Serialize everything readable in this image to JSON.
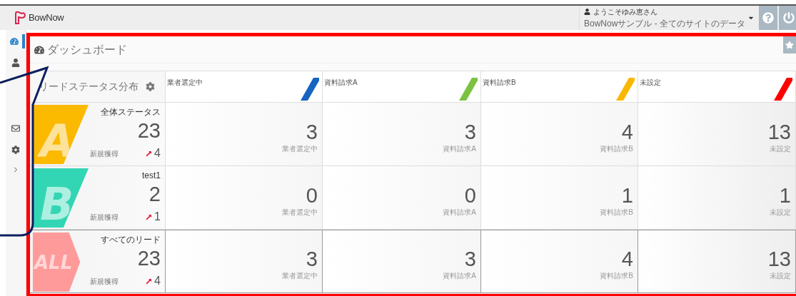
{
  "app": {
    "logo": "BowNow"
  },
  "user": {
    "greeting": "ようこそゆみ恵さん",
    "site": "BowNowサンプル - 全てのサイトのデータ"
  },
  "sidebar": [
    {
      "kind": "dashboard",
      "selected": true
    },
    {
      "kind": "person",
      "selected": false
    },
    {
      "kind": "mail",
      "selected": false
    },
    {
      "kind": "gear",
      "selected": false
    },
    {
      "kind": "collapse",
      "selected": false
    }
  ],
  "dashboard": {
    "title": "ダッシュボード",
    "panel_title": "リードステータス分布",
    "columns": [
      {
        "label": "業者選定中",
        "color": "#1565c0"
      },
      {
        "label": "資料請求A",
        "color": "#7cc242"
      },
      {
        "label": "資料請求B",
        "color": "#f9b700"
      },
      {
        "label": "未設定",
        "color": "#ff0000"
      }
    ],
    "rows": [
      {
        "badge": "A",
        "kind": "slant",
        "color": "#fbb900",
        "name": "全体ステータス",
        "total": "23",
        "new_label": "新規獲得",
        "new_count": "4",
        "cells": [
          {
            "value": "3",
            "label": "業者選定中"
          },
          {
            "value": "3",
            "label": "資料請求A"
          },
          {
            "value": "4",
            "label": "資料請求B"
          },
          {
            "value": "13",
            "label": "未設定"
          }
        ]
      },
      {
        "badge": "B",
        "kind": "slant",
        "color": "#33d6b4",
        "name": "test1",
        "total": "2",
        "new_label": "新規獲得",
        "new_count": "1",
        "cells": [
          {
            "value": "0",
            "label": "業者選定中"
          },
          {
            "value": "0",
            "label": "資料請求A"
          },
          {
            "value": "1",
            "label": "資料請求B"
          },
          {
            "value": "1",
            "label": "未設定"
          }
        ]
      },
      {
        "badge": "ALL",
        "kind": "arrow",
        "color": "#ff9a9a",
        "name": "すべてのリード",
        "total": "23",
        "new_label": "新規獲得",
        "new_count": "4",
        "cells": [
          {
            "value": "3",
            "label": "業者選定中"
          },
          {
            "value": "3",
            "label": "資料請求A"
          },
          {
            "value": "4",
            "label": "資料請求B"
          },
          {
            "value": "13",
            "label": "未設定"
          }
        ]
      }
    ]
  }
}
